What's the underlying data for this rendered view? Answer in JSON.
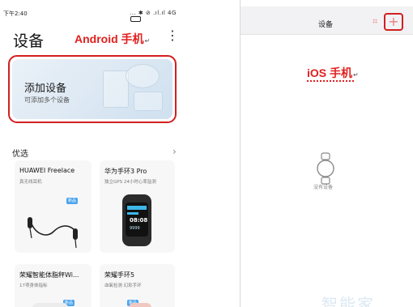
{
  "android": {
    "status_bar": {
      "time": "下午2:40",
      "icons": "... ✱ ⊘ .ıl.ıl 4G"
    },
    "title": "设备",
    "platform_label": "Android 手机",
    "add_card": {
      "title": "添加设备",
      "subtitle": "可添加多个设备"
    },
    "section": {
      "title": "优选",
      "arrow": "›"
    },
    "products": [
      {
        "name": "HUAWEI Freelace",
        "desc": "真无线耳机",
        "badge": "新品"
      },
      {
        "name": "华为手环3 Pro",
        "desc": "独立GPS 24小时心率监测",
        "badge": ""
      },
      {
        "name": "荣耀智能体脂秤Wi...",
        "desc": "17项身体指标",
        "badge": "新品"
      },
      {
        "name": "荣耀手环5",
        "desc": "血氧检测 幻彩手环",
        "badge": "新品"
      }
    ],
    "band_screen": {
      "time": "08:08",
      "steps": "9999"
    }
  },
  "ios": {
    "title": "设备",
    "platform_label": "iOS 手机",
    "empty_text": "没有设备",
    "watermark": "智能家"
  },
  "colors": {
    "annotation_red": "#e0201e",
    "card_bg": "#f7f7f8",
    "badge_blue": "#4aa3ee"
  }
}
